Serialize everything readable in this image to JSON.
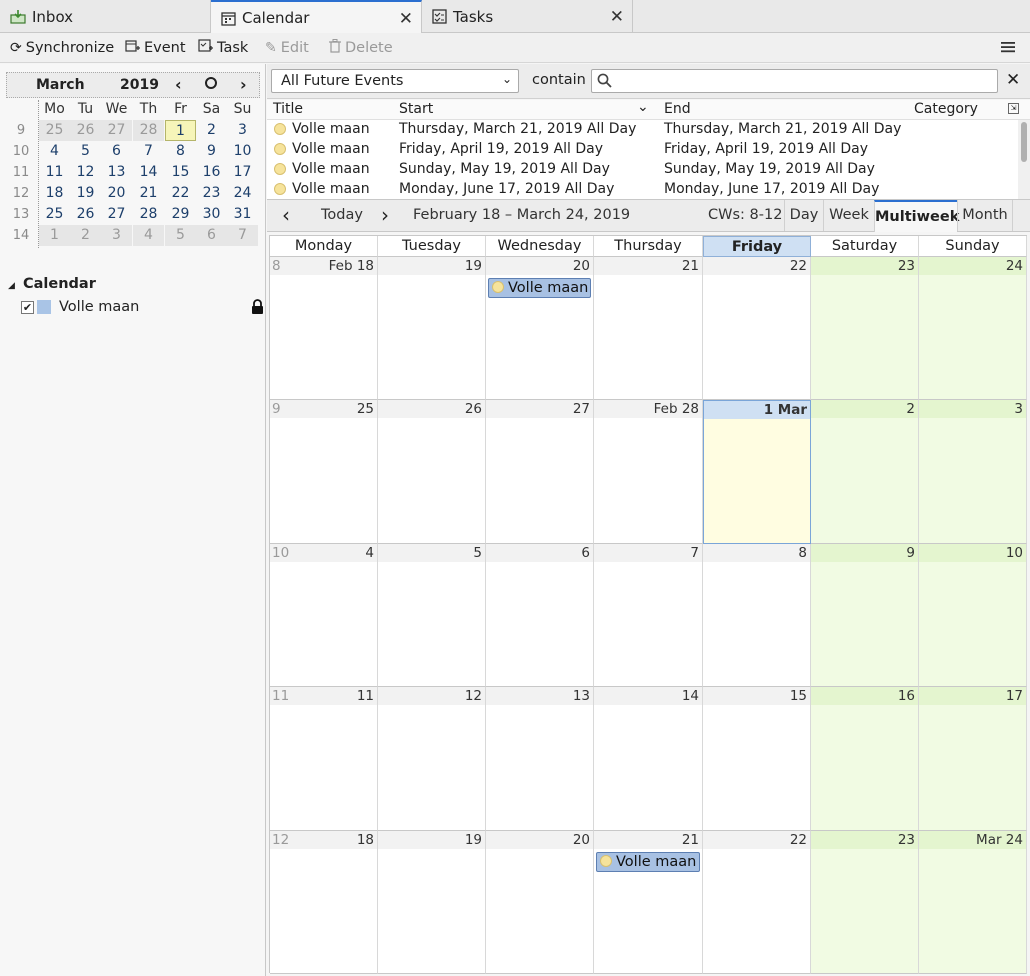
{
  "tabs": [
    {
      "label": "Inbox",
      "icon": "inbox-icon"
    },
    {
      "label": "Calendar",
      "icon": "calendar-icon"
    },
    {
      "label": "Tasks",
      "icon": "tasks-icon"
    }
  ],
  "toolbar": {
    "synchronize": "Synchronize",
    "event": "Event",
    "task": "Task",
    "edit": "Edit",
    "delete": "Delete"
  },
  "minimonth": {
    "month": "March",
    "year": "2019",
    "day_headers": [
      "Mo",
      "Tu",
      "We",
      "Th",
      "Fr",
      "Sa",
      "Su"
    ],
    "weeks": [
      {
        "wk": "9",
        "days": [
          "25",
          "26",
          "27",
          "28",
          "1",
          "2",
          "3"
        ]
      },
      {
        "wk": "10",
        "days": [
          "4",
          "5",
          "6",
          "7",
          "8",
          "9",
          "10"
        ]
      },
      {
        "wk": "11",
        "days": [
          "11",
          "12",
          "13",
          "14",
          "15",
          "16",
          "17"
        ]
      },
      {
        "wk": "12",
        "days": [
          "18",
          "19",
          "20",
          "21",
          "22",
          "23",
          "24"
        ]
      },
      {
        "wk": "13",
        "days": [
          "25",
          "26",
          "27",
          "28",
          "29",
          "30",
          "31"
        ]
      },
      {
        "wk": "14",
        "days": [
          "1",
          "2",
          "3",
          "4",
          "5",
          "6",
          "7"
        ]
      }
    ]
  },
  "calendars": {
    "section_title": "Calendar",
    "items": [
      {
        "name": "Volle maan",
        "color": "#a9c4e6",
        "checked": true
      }
    ]
  },
  "filter": {
    "selected": "All Future Events",
    "contain_label": "contain",
    "search_value": ""
  },
  "event_list": {
    "columns": {
      "title": "Title",
      "start": "Start",
      "end": "End",
      "category": "Category"
    },
    "rows": [
      {
        "title": "Volle maan",
        "start": "Thursday, March 21, 2019 All Day",
        "end": "Thursday, March 21, 2019 All Day"
      },
      {
        "title": "Volle maan",
        "start": "Friday, April 19, 2019 All Day",
        "end": "Friday, April 19, 2019 All Day"
      },
      {
        "title": "Volle maan",
        "start": "Sunday, May 19, 2019 All Day",
        "end": "Sunday, May 19, 2019 All Day"
      },
      {
        "title": "Volle maan",
        "start": "Monday, June 17, 2019 All Day",
        "end": "Monday, June 17, 2019 All Day"
      }
    ]
  },
  "nav": {
    "today": "Today",
    "range": "February 18 – March 24, 2019",
    "cws": "CWs: 8-12",
    "views": [
      "Day",
      "Week",
      "Multiweek",
      "Month"
    ],
    "active_view": "Multiweek"
  },
  "grid": {
    "day_names": [
      "Monday",
      "Tuesday",
      "Wednesday",
      "Thursday",
      "Friday",
      "Saturday",
      "Sunday"
    ],
    "today_column": 4,
    "weeks": [
      {
        "wk": "8",
        "days": [
          "Feb 18",
          "19",
          "20",
          "21",
          "22",
          "23",
          "24"
        ]
      },
      {
        "wk": "9",
        "days": [
          "25",
          "26",
          "27",
          "Feb 28",
          "1 Mar",
          "2",
          "3"
        ]
      },
      {
        "wk": "10",
        "days": [
          "4",
          "5",
          "6",
          "7",
          "8",
          "9",
          "10"
        ]
      },
      {
        "wk": "11",
        "days": [
          "11",
          "12",
          "13",
          "14",
          "15",
          "16",
          "17"
        ]
      },
      {
        "wk": "12",
        "days": [
          "18",
          "19",
          "20",
          "21",
          "22",
          "23",
          "Mar 24"
        ]
      }
    ],
    "events": [
      {
        "week": 0,
        "day": 2,
        "title": "Volle maan"
      },
      {
        "week": 4,
        "day": 3,
        "title": "Volle maan"
      }
    ]
  }
}
